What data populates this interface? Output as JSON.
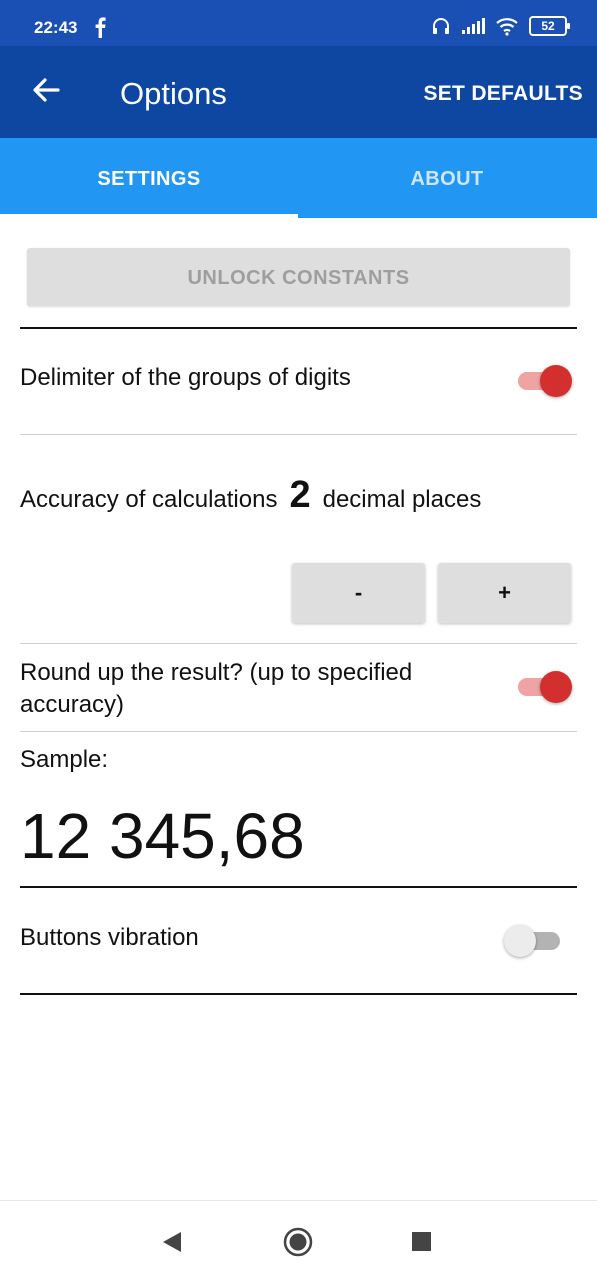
{
  "status_bar": {
    "time": "22:43",
    "battery": "52",
    "icons": [
      "facebook-icon",
      "headphones-icon",
      "signal-icon",
      "wifi-icon",
      "battery-icon"
    ]
  },
  "toolbar": {
    "title": "Options",
    "set_defaults_label": "SET DEFAULTS"
  },
  "tabs": [
    {
      "label": "SETTINGS",
      "selected": true
    },
    {
      "label": "ABOUT",
      "selected": false
    }
  ],
  "unlock_button_label": "UNLOCK CONSTANTS",
  "settings": {
    "delimiter_label": "Delimiter of the groups of digits",
    "delimiter_on": true,
    "accuracy_prefix": "Accuracy of calculations",
    "accuracy_value": "2",
    "accuracy_suffix": "decimal places",
    "minus_label": "-",
    "plus_label": "+",
    "round_label_line1": "Round up the result? (up to specified",
    "round_label_line2": "accuracy)",
    "round_on": true,
    "sample_label": "Sample:",
    "sample_value": "12 345,68",
    "vibration_label": "Buttons vibration",
    "vibration_on": false
  },
  "colors": {
    "status_bar": "#1a4fb3",
    "toolbar": "#0d47a1",
    "tabs": "#2196f3",
    "switch_on": "#d32f2f"
  }
}
